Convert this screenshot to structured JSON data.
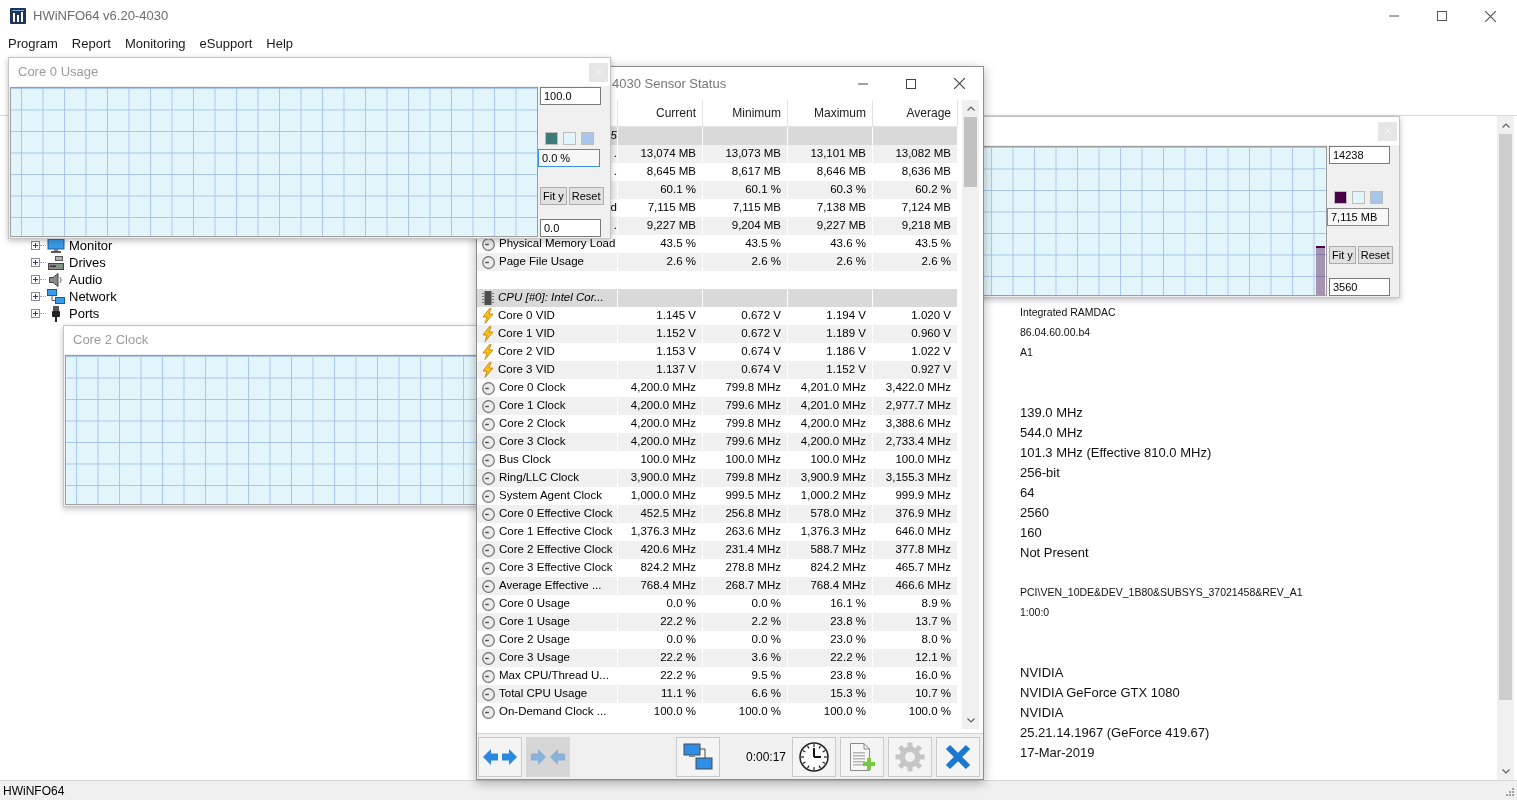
{
  "window": {
    "title": "HWiNFO64 v6.20-4030"
  },
  "menu": [
    "Program",
    "Report",
    "Monitoring",
    "eSupport",
    "Help"
  ],
  "tree": [
    {
      "label": "Monitor",
      "kind": "monitor",
      "expanded": false
    },
    {
      "label": "Drives",
      "kind": "drives",
      "expanded": false
    },
    {
      "label": "Audio",
      "kind": "audio",
      "expanded": false
    },
    {
      "label": "Network",
      "kind": "network",
      "expanded": false
    },
    {
      "label": "Ports",
      "kind": "ports",
      "expanded": false
    }
  ],
  "details": [
    {
      "kind": "small",
      "lines": [
        "Integrated RAMDAC",
        "86.04.60.00.b4",
        "A1"
      ]
    },
    {
      "kind": "normal",
      "lines": [
        "139.0 MHz",
        "544.0 MHz",
        "101.3 MHz (Effective 810.0 MHz)",
        "256-bit",
        "64",
        "2560",
        "160",
        "Not Present"
      ]
    },
    {
      "kind": "small",
      "lines": [
        "PCI\\VEN_10DE&DEV_1B80&SUBSYS_37021458&REV_A1",
        "1:00:0"
      ]
    },
    {
      "kind": "normal",
      "lines": [
        "NVIDIA",
        "NVIDIA GeForce GTX 1080",
        "NVIDIA",
        "25.21.14.1967 (GeForce 419.67)",
        "17-Mar-2019"
      ]
    }
  ],
  "status_bar": {
    "text": "HWiNFO64"
  },
  "graph_windows": [
    {
      "title": "Core 0 Usage",
      "controls": {
        "top_value": "100.0",
        "swatches": [
          {
            "color": "#3d7b78"
          },
          {
            "color": "#e2f5fb"
          },
          {
            "color": "#a9c5ea"
          }
        ],
        "reading": {
          "value": "0.0 %",
          "focused": true
        },
        "buttons": [
          "Fit y",
          "Reset"
        ],
        "bottom_value": "0.0"
      }
    },
    {
      "level": 0.33,
      "controls": {
        "top_value": "14238",
        "swatches": [
          {
            "color": "#4a0046"
          },
          {
            "color": "#e2f5fb"
          },
          {
            "color": "#a9c5ea"
          }
        ],
        "reading": {
          "value": "7,115 MB",
          "focused": false
        },
        "buttons": [
          "Fit y",
          "Reset"
        ],
        "bottom_value": "3560"
      }
    },
    {
      "title": "Core 2 Clock"
    }
  ],
  "sensor_window": {
    "title": "4030 Sensor Status",
    "columns": [
      "Current",
      "Minimum",
      "Maximum",
      "Average"
    ],
    "rows": [
      {
        "kind": "group",
        "label_tail": "5"
      },
      {
        "kind": "sensor",
        "label_tail": ".",
        "values": [
          "13,074 MB",
          "13,073 MB",
          "13,101 MB",
          "13,082 MB"
        ]
      },
      {
        "kind": "sensor",
        "label_tail": ".",
        "values": [
          "8,645 MB",
          "8,617 MB",
          "8,646 MB",
          "8,636 MB"
        ]
      },
      {
        "kind": "sensor",
        "values": [
          "60.1 %",
          "60.1 %",
          "60.3 %",
          "60.2 %"
        ]
      },
      {
        "kind": "sensor",
        "label_tail": "d",
        "values": [
          "7,115 MB",
          "7,115 MB",
          "7,138 MB",
          "7,124 MB"
        ]
      },
      {
        "kind": "sensor",
        "label_tail": ".",
        "values": [
          "9,227 MB",
          "9,204 MB",
          "9,227 MB",
          "9,218 MB"
        ]
      },
      {
        "kind": "sensor",
        "label": "Physical Memory Load",
        "values": [
          "43.5 %",
          "43.5 %",
          "43.6 %",
          "43.5 %"
        ]
      },
      {
        "kind": "sensor",
        "label": "Page File Usage",
        "values": [
          "2.6 %",
          "2.6 %",
          "2.6 %",
          "2.6 %"
        ]
      },
      {
        "kind": "spacer"
      },
      {
        "kind": "group",
        "label": "CPU [#0]: Intel Cor..."
      },
      {
        "kind": "voltage",
        "label": "Core 0 VID",
        "values": [
          "1.145 V",
          "0.672 V",
          "1.194 V",
          "1.020 V"
        ]
      },
      {
        "kind": "voltage",
        "label": "Core 1 VID",
        "values": [
          "1.152 V",
          "0.672 V",
          "1.189 V",
          "0.960 V"
        ]
      },
      {
        "kind": "voltage",
        "label": "Core 2 VID",
        "values": [
          "1.153 V",
          "0.674 V",
          "1.186 V",
          "1.022 V"
        ]
      },
      {
        "kind": "voltage",
        "label": "Core 3 VID",
        "values": [
          "1.137 V",
          "0.674 V",
          "1.152 V",
          "0.927 V"
        ]
      },
      {
        "kind": "sensor",
        "label": "Core 0 Clock",
        "values": [
          "4,200.0 MHz",
          "799.8 MHz",
          "4,201.0 MHz",
          "3,422.0 MHz"
        ]
      },
      {
        "kind": "sensor",
        "label": "Core 1 Clock",
        "values": [
          "4,200.0 MHz",
          "799.6 MHz",
          "4,201.0 MHz",
          "2,977.7 MHz"
        ]
      },
      {
        "kind": "sensor",
        "label": "Core 2 Clock",
        "values": [
          "4,200.0 MHz",
          "799.8 MHz",
          "4,200.0 MHz",
          "3,388.6 MHz"
        ]
      },
      {
        "kind": "sensor",
        "label": "Core 3 Clock",
        "values": [
          "4,200.0 MHz",
          "799.6 MHz",
          "4,200.0 MHz",
          "2,733.4 MHz"
        ]
      },
      {
        "kind": "sensor",
        "label": "Bus Clock",
        "values": [
          "100.0 MHz",
          "100.0 MHz",
          "100.0 MHz",
          "100.0 MHz"
        ]
      },
      {
        "kind": "sensor",
        "label": "Ring/LLC Clock",
        "values": [
          "3,900.0 MHz",
          "799.8 MHz",
          "3,900.9 MHz",
          "3,155.3 MHz"
        ]
      },
      {
        "kind": "sensor",
        "label": "System Agent Clock",
        "values": [
          "1,000.0 MHz",
          "999.5 MHz",
          "1,000.2 MHz",
          "999.9 MHz"
        ]
      },
      {
        "kind": "sensor",
        "label": "Core 0 Effective Clock",
        "values": [
          "452.5 MHz",
          "256.8 MHz",
          "578.0 MHz",
          "376.9 MHz"
        ]
      },
      {
        "kind": "sensor",
        "label": "Core 1 Effective Clock",
        "values": [
          "1,376.3 MHz",
          "263.6 MHz",
          "1,376.3 MHz",
          "646.0 MHz"
        ]
      },
      {
        "kind": "sensor",
        "label": "Core 2 Effective Clock",
        "values": [
          "420.6 MHz",
          "231.4 MHz",
          "588.7 MHz",
          "377.8 MHz"
        ]
      },
      {
        "kind": "sensor",
        "label": "Core 3 Effective Clock",
        "values": [
          "824.2 MHz",
          "278.8 MHz",
          "824.2 MHz",
          "465.7 MHz"
        ]
      },
      {
        "kind": "sensor",
        "label": "Average Effective ...",
        "values": [
          "768.4 MHz",
          "268.7 MHz",
          "768.4 MHz",
          "466.6 MHz"
        ]
      },
      {
        "kind": "sensor",
        "label": "Core 0 Usage",
        "values": [
          "0.0 %",
          "0.0 %",
          "16.1 %",
          "8.9 %"
        ]
      },
      {
        "kind": "sensor",
        "label": "Core 1 Usage",
        "values": [
          "22.2 %",
          "2.2 %",
          "23.8 %",
          "13.7 %"
        ]
      },
      {
        "kind": "sensor",
        "label": "Core 2 Usage",
        "values": [
          "0.0 %",
          "0.0 %",
          "23.0 %",
          "8.0 %"
        ]
      },
      {
        "kind": "sensor",
        "label": "Core 3 Usage",
        "values": [
          "22.2 %",
          "3.6 %",
          "22.2 %",
          "12.1 %"
        ]
      },
      {
        "kind": "sensor",
        "label": "Max CPU/Thread U...",
        "values": [
          "22.2 %",
          "9.5 %",
          "23.8 %",
          "16.0 %"
        ]
      },
      {
        "kind": "sensor",
        "label": "Total CPU Usage",
        "values": [
          "11.1 %",
          "6.6 %",
          "15.3 %",
          "10.7 %"
        ]
      },
      {
        "kind": "sensor",
        "label": "On-Demand Clock ...",
        "values": [
          "100.0 %",
          "100.0 %",
          "100.0 %",
          "100.0 %"
        ]
      }
    ],
    "toolbar": [
      {
        "kind": "expand",
        "pressed": false,
        "disabled": false
      },
      {
        "kind": "collapse",
        "pressed": true,
        "disabled": true
      },
      {
        "kind": "network",
        "pressed": false,
        "disabled": false
      },
      {
        "kind": "clock",
        "pressed": false,
        "disabled": false
      },
      {
        "kind": "report",
        "pressed": false,
        "disabled": false
      },
      {
        "kind": "settings",
        "pressed": false,
        "disabled": true
      },
      {
        "kind": "close",
        "pressed": false,
        "disabled": false
      }
    ],
    "elapsed": "0:00:17"
  }
}
